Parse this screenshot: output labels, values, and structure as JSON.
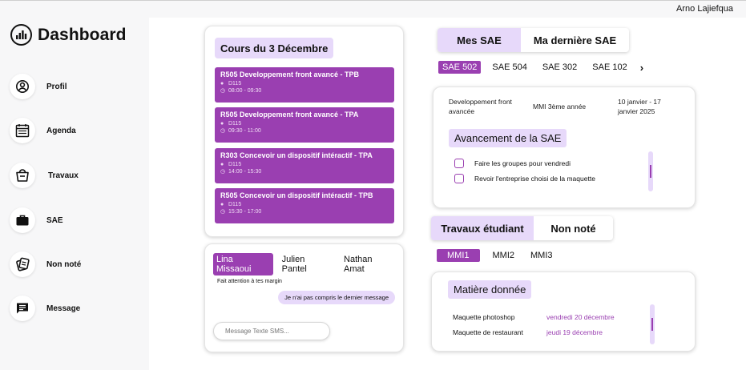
{
  "header": {
    "user_name": "Arno Lajiefqua"
  },
  "sidebar": {
    "title": "Dashboard",
    "logo_icon": "dashboard-logo-icon",
    "items": [
      {
        "label": "Profil",
        "icon": "user-circle-icon"
      },
      {
        "label": "Agenda",
        "icon": "calendar-icon"
      },
      {
        "label": "Travaux",
        "icon": "works-bag-icon"
      },
      {
        "label": "SAE",
        "icon": "briefcase-icon"
      },
      {
        "label": "Non noté",
        "icon": "cards-icon"
      },
      {
        "label": "Message",
        "icon": "message-icon"
      }
    ]
  },
  "courses": {
    "title": "Cours du 3 Décembre",
    "items": [
      {
        "name": "R505 Developpement front avancé - TPB",
        "room": "D115",
        "time": "08:00 - 09:30"
      },
      {
        "name": "R505 Developpement front avancé - TPA",
        "room": "D115",
        "time": "09:30 - 11:00"
      },
      {
        "name": "R303 Concevoir un dispositif intéractif - TPA",
        "room": "D115",
        "time": "14:00 - 15:30"
      },
      {
        "name": "R505 Concevoir un dispositif intéractif - TPB",
        "room": "D115",
        "time": "15:30 - 17:00"
      }
    ],
    "colors": {
      "item_bg": "#9a3fb1",
      "accent_light": "#e7d9fa"
    }
  },
  "chat": {
    "tabs": [
      "Lina Missaoui",
      "Julien Pantel",
      "Nathan Amat"
    ],
    "active_tab": "Lina Missaoui",
    "received": "Fait attention à tes margin",
    "sent": "Je n'ai pas compris le dernier message",
    "input_placeholder": "Message Texte SMS..."
  },
  "sae": {
    "segments": [
      "Mes SAE",
      "Ma dernière SAE"
    ],
    "active_segment": "Mes SAE",
    "tabs": [
      "SAE 502",
      "SAE 504",
      "SAE 302",
      "SAE 102"
    ],
    "active_tab": "SAE 502",
    "next_icon": "chevron-right-icon",
    "info": {
      "subject": "Developpement front avancée",
      "year": "MMI 3ème année",
      "dates": "10 janvier - 17 janvier 2025"
    },
    "progress_title": "Avancement de la SAE",
    "tasks": [
      {
        "label": "Faire les groupes pour vendredi",
        "checked": false
      },
      {
        "label": "Revoir l'entreprise choisi de la maquette",
        "checked": false
      }
    ]
  },
  "travaux": {
    "segments": [
      "Travaux étudiant",
      "Non noté"
    ],
    "active_segment": "Travaux étudiant",
    "tabs": [
      "MMI1",
      "MMI2",
      "MMI3"
    ],
    "active_tab": "MMI1",
    "section_title": "Matière donnée",
    "rows": [
      {
        "name": "Maquette photoshop",
        "date": "vendredi 20 décembre"
      },
      {
        "name": "Maquette de restaurant",
        "date": "jeudi 19 décembre"
      }
    ]
  }
}
